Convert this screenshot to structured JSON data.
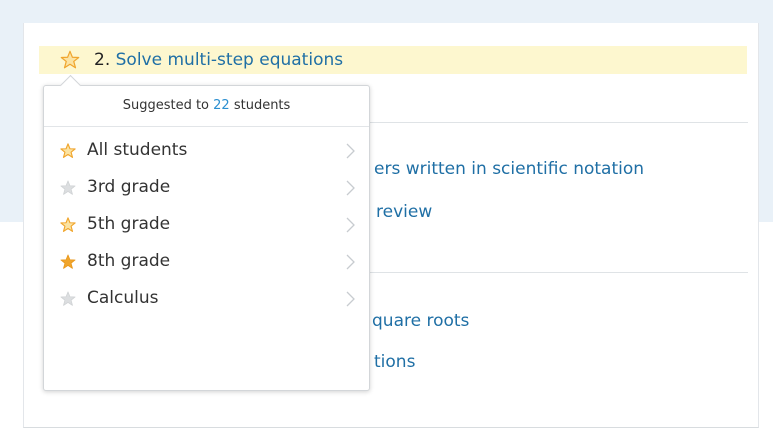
{
  "skill": {
    "number": "2.",
    "title": "Solve multi-step equations",
    "star_state": "outline"
  },
  "background_items": [
    "ers written in scientific notation",
    "review",
    "quare roots",
    "tions"
  ],
  "popover": {
    "suggested_prefix": "Suggested to",
    "suggested_count": "22",
    "suggested_suffix": "students",
    "items": [
      {
        "label": "All students",
        "star": "outline-gold"
      },
      {
        "label": "3rd grade",
        "star": "gray"
      },
      {
        "label": "5th grade",
        "star": "outline-gold"
      },
      {
        "label": "8th grade",
        "star": "solid-gold"
      },
      {
        "label": "Calculus",
        "star": "gray"
      }
    ]
  },
  "colors": {
    "link": "#1f6fa5",
    "count": "#2b8fd0",
    "star_gold": "#f0a52c",
    "star_gray": "#d4d6d8",
    "highlight": "#fdf7cf",
    "top_band": "#e9f1f8"
  },
  "icons": {
    "skill_star": "star-icon",
    "item_chevron": "chevron-right-icon"
  }
}
